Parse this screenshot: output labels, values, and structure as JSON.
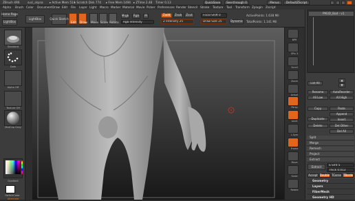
{
  "titlebar": {
    "segments": [
      "ZBrush 4R6",
      "suci_skyna",
      "▸ Active Mem 514",
      "▸ Scratch Disk 774",
      "▸ Free Mem 1494",
      "▸ ZTime 2.48",
      "Timer 0.13"
    ],
    "quicksave": "QuickSave",
    "seethrough": "See-through 0",
    "menus": "Menus",
    "defaultscript": "DefaultZScript"
  },
  "menubar": {
    "items": [
      "Alpha",
      "Brush",
      "Color",
      "Document",
      "Draw",
      "Edit",
      "File",
      "Layer",
      "Light",
      "Macro",
      "Marker",
      "Material",
      "Movie",
      "Picker",
      "Preferences",
      "Render",
      "Stencil",
      "Stroke",
      "Texture",
      "Tool",
      "Transform",
      "Zplugin",
      "Zscript"
    ]
  },
  "toolbar": {
    "home_page": "Home Page",
    "lightbox": "LightBox",
    "quick_sketch": "Quick Sketch",
    "edit": "Edit",
    "draw": "Draw",
    "move": "Move",
    "scale": "Scale",
    "rotate": "Rotate",
    "mrgb": "Mrgb",
    "rgb": "Rgb",
    "m": "M",
    "zadd": "Zadd",
    "zsub": "Zsub",
    "zcut": "Zcut",
    "rgb_intensity": "Rgb Intensity",
    "z_intensity": "Z Intensity 25",
    "focal_shift": "Focal Shift 0",
    "draw_size": "Draw Size 25",
    "dynamic": "Dynamic",
    "active_points": "ActivePoints: 1.638 Mil",
    "total_points": "TotalPoints: 1.141 Mil"
  },
  "leftshelf": {
    "thumbs": [
      "Standard",
      "Dots",
      "Alpha Off",
      "Texture Off",
      "MatCap Gray"
    ],
    "gradient": "Gradient",
    "switch_color": "SwitchColor",
    "alternate": "Alternate"
  },
  "rightshelf": {
    "icons": [
      "BPR",
      "SPix 3",
      "Scroll",
      "Zoom",
      "Actual",
      "AAHalf",
      "Persp",
      "Floor",
      "Local",
      "L.Sym",
      "Frame",
      "Move",
      "Scale",
      "Rotate",
      "PolyF",
      "Transp",
      "Solo"
    ]
  },
  "rightpanel": {
    "subtool_slot": "PM3D_Bod - v1",
    "list_all": "List All",
    "rename": "Rename",
    "autoreorder": "AutoReorder",
    "all_low": "All Low",
    "all_high": "All High",
    "copy": "Copy",
    "paste": "Paste",
    "append": "Append",
    "duplicate": "Duplicate",
    "insert": "Insert",
    "delete": "Delete",
    "del_other": "Del Other",
    "del_all": "Del All",
    "split": "Split",
    "merge": "Merge",
    "remesh": "Remesh",
    "project": "Project",
    "extract": "Extract",
    "s_smt": "S Smt 5",
    "thick": "Thick 0.013",
    "accept": "Accept",
    "double": "Double",
    "tcorne": "TCorne",
    "tborde": "TBorde",
    "sections": [
      "Geometry",
      "Layers",
      "FiberMesh",
      "Geometry HD",
      "Preview"
    ]
  },
  "colors": {
    "accent": "#e0661e",
    "panel": "#3d3d3d",
    "canvas_top": "#5d5d5d",
    "canvas_bottom": "#181818"
  }
}
